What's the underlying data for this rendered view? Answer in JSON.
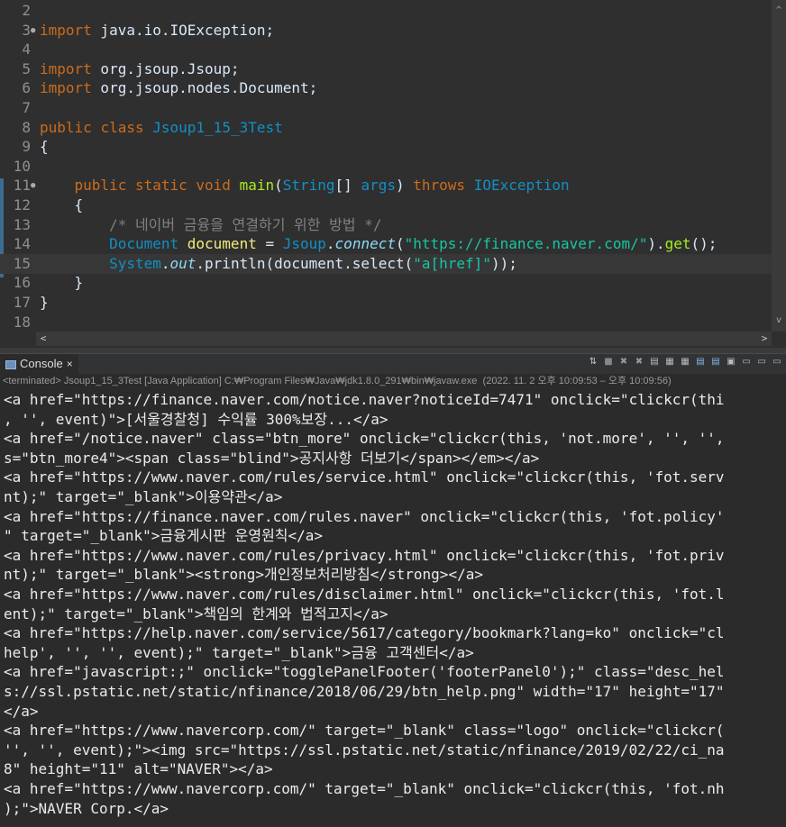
{
  "editor": {
    "lines": [
      {
        "n": "2",
        "segs": []
      },
      {
        "n": "3",
        "marker": true,
        "segs": [
          [
            "kw",
            "import"
          ],
          [
            "t",
            " java.io.IOException;"
          ]
        ]
      },
      {
        "n": "4",
        "segs": []
      },
      {
        "n": "5",
        "segs": [
          [
            "kw",
            "import"
          ],
          [
            "t",
            " org.jsoup.Jsoup;"
          ]
        ]
      },
      {
        "n": "6",
        "segs": [
          [
            "kw",
            "import"
          ],
          [
            "t",
            " org.jsoup.nodes.Document;"
          ]
        ]
      },
      {
        "n": "7",
        "segs": []
      },
      {
        "n": "8",
        "segs": [
          [
            "kw",
            "public"
          ],
          [
            "t",
            " "
          ],
          [
            "kw",
            "class"
          ],
          [
            "t",
            " "
          ],
          [
            "cls",
            "Jsoup1_15_3Test"
          ]
        ]
      },
      {
        "n": "9",
        "segs": [
          [
            "t",
            "{"
          ]
        ]
      },
      {
        "n": "10",
        "segs": []
      },
      {
        "n": "11",
        "marker": true,
        "segs": [
          [
            "t",
            "    "
          ],
          [
            "kw",
            "public"
          ],
          [
            "t",
            " "
          ],
          [
            "kw",
            "static"
          ],
          [
            "t",
            " "
          ],
          [
            "kw",
            "void"
          ],
          [
            "t",
            " "
          ],
          [
            "fn",
            "main"
          ],
          [
            "t",
            "("
          ],
          [
            "cls",
            "String"
          ],
          [
            "t",
            "[] "
          ],
          [
            "cls",
            "args"
          ],
          [
            "t",
            ") "
          ],
          [
            "kw",
            "throws"
          ],
          [
            "t",
            " "
          ],
          [
            "cls",
            "IOException"
          ]
        ]
      },
      {
        "n": "12",
        "segs": [
          [
            "t",
            "    {"
          ]
        ]
      },
      {
        "n": "13",
        "segs": [
          [
            "t",
            "        "
          ],
          [
            "cm",
            "/* 네이버 금융을 연결하기 위한 방법 */"
          ]
        ]
      },
      {
        "n": "14",
        "segs": [
          [
            "t",
            "        "
          ],
          [
            "cls",
            "Document"
          ],
          [
            "t",
            " "
          ],
          [
            "var",
            "document"
          ],
          [
            "t",
            " = "
          ],
          [
            "cls",
            "Jsoup"
          ],
          [
            "t",
            "."
          ],
          [
            "it",
            "connect"
          ],
          [
            "t",
            "("
          ],
          [
            "str",
            "\"https://finance.naver.com/\""
          ],
          [
            "t",
            ")."
          ],
          [
            "fn",
            "get"
          ],
          [
            "t",
            "();"
          ]
        ]
      },
      {
        "n": "15",
        "current": true,
        "segs": [
          [
            "t",
            "        "
          ],
          [
            "cls",
            "System"
          ],
          [
            "t",
            "."
          ],
          [
            "it",
            "out"
          ],
          [
            "t",
            ".println(document.select("
          ],
          [
            "str",
            "\"a[href]\""
          ],
          [
            "t",
            "));"
          ]
        ]
      },
      {
        "n": "16",
        "segs": [
          [
            "t",
            "    }"
          ]
        ]
      },
      {
        "n": "17",
        "segs": [
          [
            "t",
            "}"
          ]
        ]
      },
      {
        "n": "18",
        "segs": []
      }
    ],
    "scroll_up": "^",
    "scroll_down": "v",
    "scroll_left": "<",
    "scroll_right": ">"
  },
  "console": {
    "tab_label": "Console",
    "tab_close": "×",
    "status": "<terminated> Jsoup1_15_3Test [Java Application] C:₩Program Files₩Java₩jdk1.8.0_291₩bin₩javaw.exe  (2022. 11. 2 오후 10:09:53 – 오후 10:09:56)",
    "toolbar_icons": [
      "pin-icon",
      "stop-icon",
      "remove-icon",
      "remove-all-icon",
      "clear-icon",
      "scroll-lock-icon",
      "word-wrap-icon",
      "show-stdout-icon",
      "show-stderr-icon",
      "display-selected-icon",
      "open-console-icon",
      "new-console-icon",
      "minimize-icon"
    ],
    "lines": [
      "<a href=\"https://finance.naver.com/notice.naver?noticeId=7471\" onclick=\"clickcr(thi",
      ", '', event)\">[서울경찰청] 수익률 300%보장...</a>",
      "<a href=\"/notice.naver\" class=\"btn_more\" onclick=\"clickcr(this, 'not.more', '', '',",
      "s=\"btn_more4\"><span class=\"blind\">공지사항 더보기</span></em></a>",
      "<a href=\"https://www.naver.com/rules/service.html\" onclick=\"clickcr(this, 'fot.serv",
      "nt);\" target=\"_blank\">이용약관</a>",
      "<a href=\"https://finance.naver.com/rules.naver\" onclick=\"clickcr(this, 'fot.policy'",
      "\" target=\"_blank\">금융게시판 운영원칙</a>",
      "<a href=\"https://www.naver.com/rules/privacy.html\" onclick=\"clickcr(this, 'fot.priv",
      "nt);\" target=\"_blank\"><strong>개인정보처리방침</strong></a>",
      "<a href=\"https://www.naver.com/rules/disclaimer.html\" onclick=\"clickcr(this, 'fot.l",
      "ent);\" target=\"_blank\">책임의 한계와 법적고지</a>",
      "<a href=\"https://help.naver.com/service/5617/category/bookmark?lang=ko\" onclick=\"cl",
      "help', '', '', event);\" target=\"_blank\">금융 고객센터</a>",
      "<a href=\"javascript:;\" onclick=\"togglePanelFooter('footerPanel0');\" class=\"desc_hel",
      "s://ssl.pstatic.net/static/nfinance/2018/06/29/btn_help.png\" width=\"17\" height=\"17\"",
      "</a>",
      "<a href=\"https://www.navercorp.com/\" target=\"_blank\" class=\"logo\" onclick=\"clickcr(",
      "'', '', event);\"><img src=\"https://ssl.pstatic.net/static/nfinance/2019/02/22/ci_na",
      "8\" height=\"11\" alt=\"NAVER\"></a>",
      "<a href=\"https://www.navercorp.com/\" target=\"_blank\" onclick=\"clickcr(this, 'fot.nh",
      ");\">NAVER Corp.</a>"
    ]
  }
}
